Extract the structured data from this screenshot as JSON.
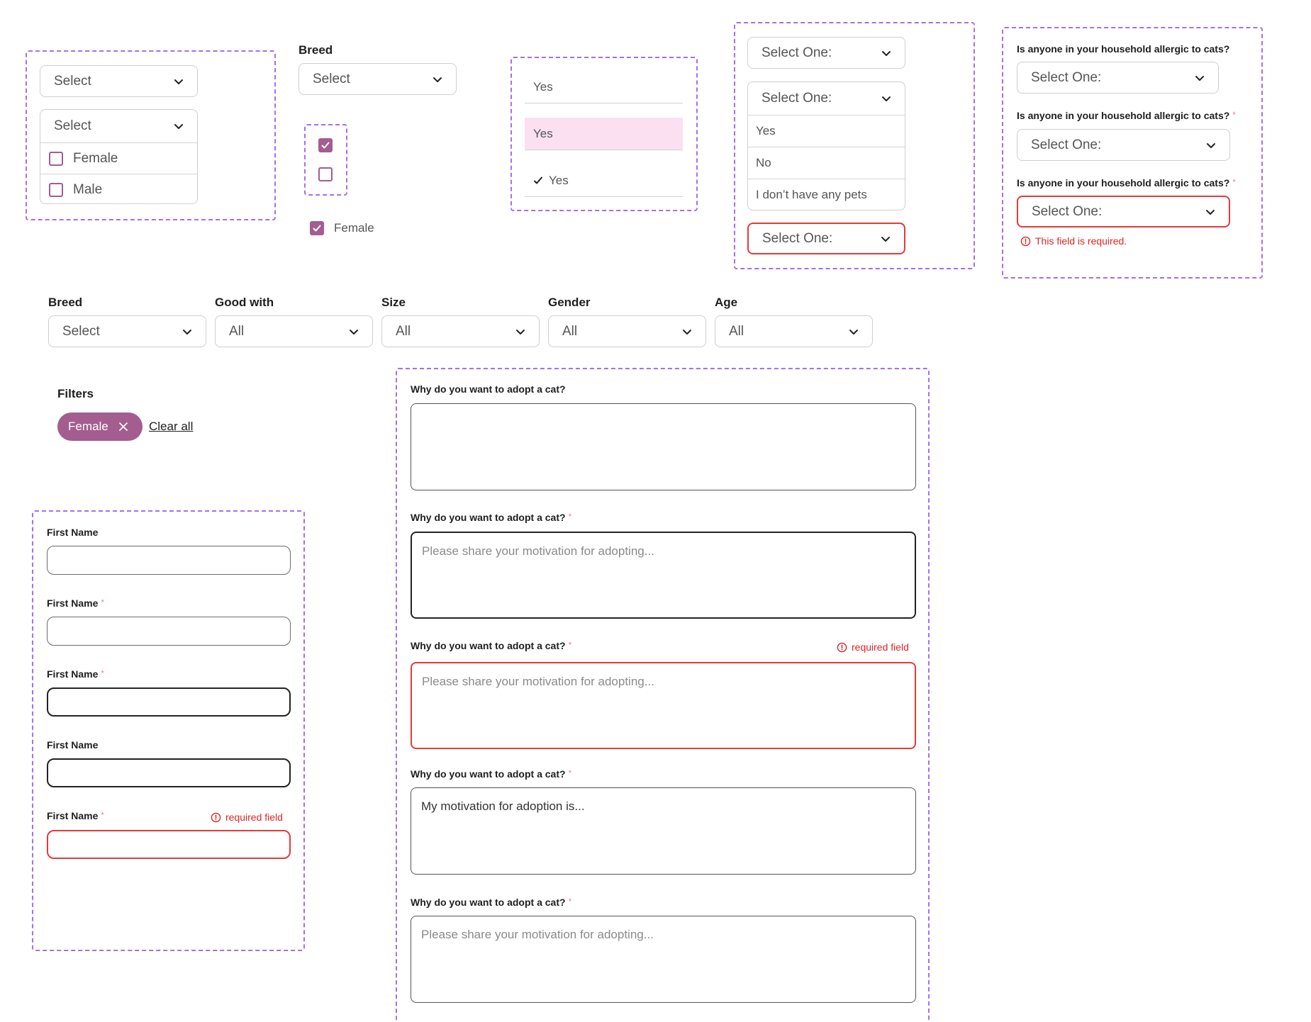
{
  "colors": {
    "accent": "#a35d8f",
    "error": "#e33a3a",
    "dashed_frame": "#a66ef0",
    "highlight": "#fbe0f2"
  },
  "group1": {
    "select_closed": "Select",
    "select_open": "Select",
    "options": [
      "Female",
      "Male"
    ]
  },
  "breed_single": {
    "label": "Breed",
    "value": "Select"
  },
  "checkbox_group": {
    "checked_label": "Female"
  },
  "yes_options": {
    "default": "Yes",
    "hover": "Yes",
    "selected": "Yes"
  },
  "select_one_group": {
    "closed": "Select One:",
    "open": "Select One:",
    "options": [
      "Yes",
      "No",
      "I don’t have any pets"
    ],
    "error": "Select One:"
  },
  "allergy_group": {
    "question": "Is anyone in your household allergic to cats?",
    "required_mark": "*",
    "value": "Select One:",
    "error_message": "This field is required."
  },
  "filter_bar": {
    "fields": [
      {
        "label": "Breed",
        "value": "Select"
      },
      {
        "label": "Good with",
        "value": "All"
      },
      {
        "label": "Size",
        "value": "All"
      },
      {
        "label": "Gender",
        "value": "All"
      },
      {
        "label": "Age",
        "value": "All"
      }
    ]
  },
  "filters": {
    "title": "Filters",
    "chip": "Female",
    "clear_all": "Clear all"
  },
  "first_name_group": {
    "label": "First Name",
    "required_mark": "*",
    "error": "required field"
  },
  "textarea_group": {
    "question": "Why do you want to adopt a cat?",
    "required_mark": "*",
    "placeholder": "Please share your motivation for adopting...",
    "filled_value": "My motivation for adoption is...",
    "error": "required field"
  },
  "icons": {
    "chevron": "chevron-down-icon",
    "check": "check-icon",
    "close": "close-icon",
    "error": "alert-circle-icon"
  }
}
